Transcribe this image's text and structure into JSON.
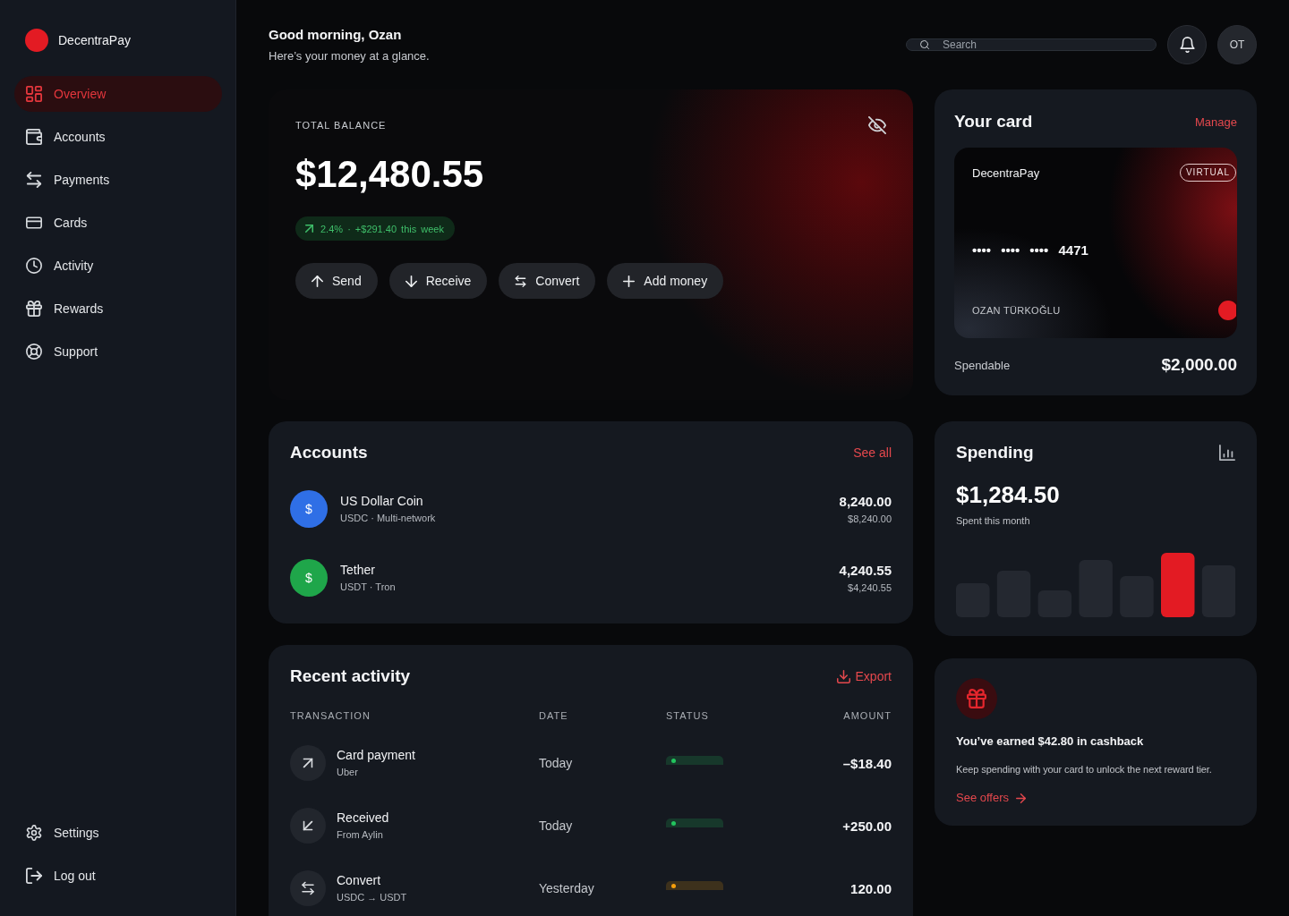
{
  "app": {
    "name": "DecentraPay"
  },
  "sidebar": {
    "items": [
      {
        "label": "Overview",
        "selected": true
      },
      {
        "label": "Accounts",
        "selected": false
      },
      {
        "label": "Payments",
        "selected": false
      },
      {
        "label": "Cards",
        "selected": false
      },
      {
        "label": "Activity",
        "selected": false
      },
      {
        "label": "Rewards",
        "selected": false
      },
      {
        "label": "Support",
        "selected": false
      }
    ],
    "footer_items": [
      {
        "label": "Settings"
      },
      {
        "label": "Log out"
      }
    ]
  },
  "header": {
    "greeting": "Good morning, Ozan",
    "subtitle": "Here’s your money at a glance.",
    "search": {
      "placeholder": "Search"
    },
    "avatar": {
      "initials": "OT"
    }
  },
  "balance": {
    "label": "TOTAL BALANCE",
    "amount": "$12,480.55",
    "change": "2.4% · +$291.40 this week",
    "actions": [
      {
        "label": "Send"
      },
      {
        "label": "Receive"
      },
      {
        "label": "Convert"
      },
      {
        "label": "Add money"
      }
    ]
  },
  "your_card": {
    "title": "Your card",
    "action": "Manage",
    "card": {
      "brand": "DecentraPay",
      "type": "VIRTUAL",
      "number": "•••• •••• •••• 4471",
      "holder": "OZAN TÜRKOĞLU"
    },
    "spendable_label": "Spendable",
    "spendable_amount": "$2,000.00"
  },
  "accounts": {
    "title": "Accounts",
    "action": "See all",
    "items": [
      {
        "symbol": "$",
        "color": "#2f6fe6",
        "name": "US Dollar Coin",
        "detail": "USDC · Multi-network",
        "amount": "8,240.00",
        "value": "$8,240.00"
      },
      {
        "symbol": "$",
        "color": "#1fa64a",
        "name": "Tether",
        "detail": "USDT · Tron",
        "amount": "4,240.55",
        "value": "$4,240.55"
      }
    ]
  },
  "spending": {
    "title": "Spending",
    "amount": "$1,284.50",
    "caption": "Spent this month"
  },
  "activity": {
    "title": "Recent activity",
    "action": "Export",
    "columns": [
      "TRANSACTION",
      "DATE",
      "STATUS",
      "AMOUNT"
    ],
    "rows": [
      {
        "kind": "sent",
        "name": "Card payment",
        "detail": "Uber",
        "date": "Today",
        "color": "#22c55e",
        "amount": "–$18.40"
      },
      {
        "kind": "received",
        "name": "Received",
        "detail": "From Aylin",
        "date": "Today",
        "color": "#22c55e",
        "amount": "+250.00"
      },
      {
        "kind": "convert",
        "name": "Convert",
        "detail": "USDC → USDT",
        "date": "Yesterday",
        "color": "#f59e0b",
        "amount": "120.00"
      }
    ]
  },
  "cashback": {
    "title": "You’ve earned $42.80 in cashback",
    "text": "Keep spending with your card to unlock the next reward tier.",
    "action": "See offers"
  }
}
